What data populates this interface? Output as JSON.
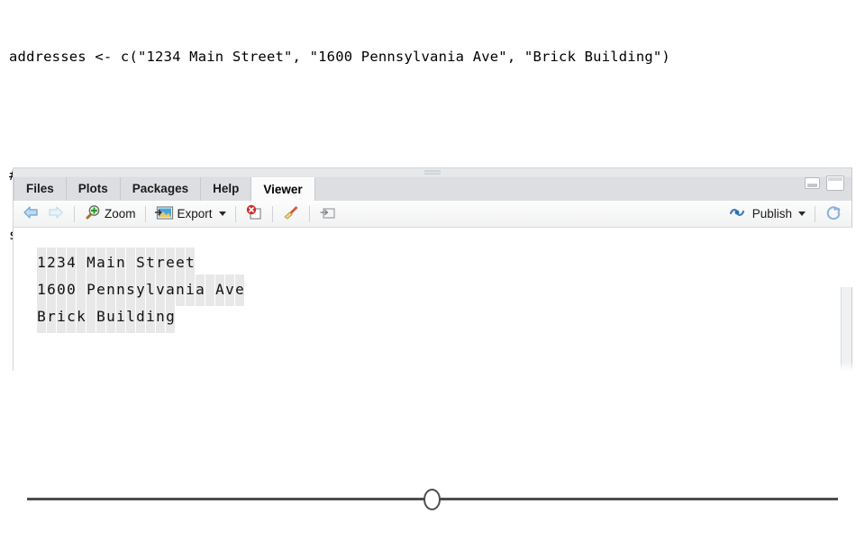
{
  "code": {
    "line1": "addresses <- c(\"1234 Main Street\", \"1600 Pennsylvania Ave\", \"Brick Building\")",
    "line2": "## identify any character",
    "line3_prefix": "str_view_all(addresses,",
    "line3_highlight": "\".\"",
    "line3_suffix": ")",
    "highlight_color": "#ee00ee"
  },
  "panel": {
    "tabs": [
      {
        "label": "Files",
        "active": false
      },
      {
        "label": "Plots",
        "active": false
      },
      {
        "label": "Packages",
        "active": false
      },
      {
        "label": "Help",
        "active": false
      },
      {
        "label": "Viewer",
        "active": true
      }
    ],
    "window_controls": {
      "minimize": "minimize-icon",
      "maximize": "maximize-icon"
    },
    "toolbar": {
      "back": "back-arrow-icon",
      "forward": "forward-arrow-icon",
      "zoom_label": "Zoom",
      "zoom_icon": "magnifier-plus-icon",
      "export_label": "Export",
      "export_icon": "export-image-icon",
      "export_caret": "chevron-down-icon",
      "remove_icon": "remove-plot-icon",
      "clear_icon": "broom-clear-icon",
      "popout_icon": "open-in-new-window-icon",
      "publish_label": "Publish",
      "publish_icon": "publish-icon",
      "publish_caret": "chevron-down-icon",
      "refresh_icon": "refresh-icon"
    },
    "viewer_output": {
      "lines": [
        "1234 Main Street",
        "1600 Pennsylvania Ave",
        "Brick Building"
      ],
      "match_highlight_color": "#e8e8e8"
    }
  },
  "divider": {
    "knob": "ellipse-knob",
    "line": "horizontal-rule"
  }
}
